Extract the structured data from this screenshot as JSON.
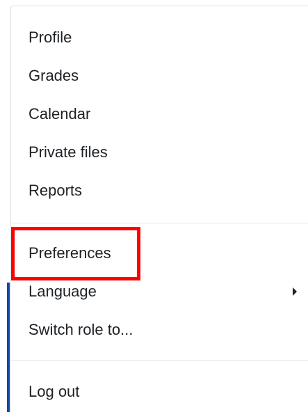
{
  "user_menu": {
    "items": [
      {
        "label": "Profile"
      },
      {
        "label": "Grades"
      },
      {
        "label": "Calendar"
      },
      {
        "label": "Private files"
      },
      {
        "label": "Reports"
      },
      {
        "label": "Preferences"
      },
      {
        "label": "Language",
        "has_submenu": true
      },
      {
        "label": "Switch role to..."
      },
      {
        "label": "Log out"
      }
    ],
    "highlighted_item": "Preferences"
  },
  "colors": {
    "text": "#1d2125",
    "divider": "#dee2e6",
    "highlight": "#ff0000",
    "accent": "#0f47ad"
  }
}
